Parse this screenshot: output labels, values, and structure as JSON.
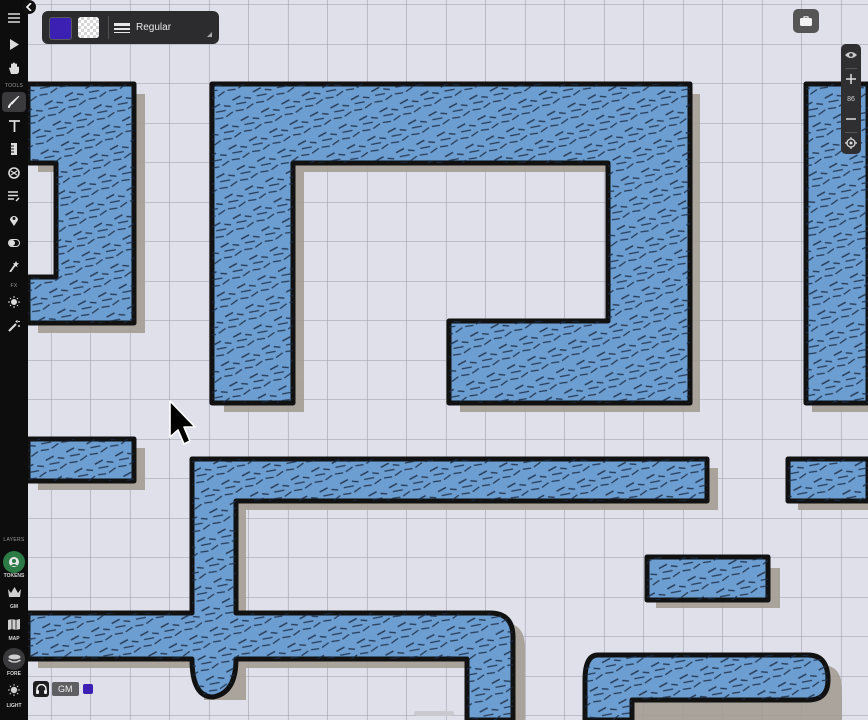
{
  "app": {
    "style_panel": {
      "fill_color": "#3c1fb3",
      "stroke_color": "transparent",
      "line_style_label": "Regular"
    },
    "toolbar": {
      "sections": {
        "tools": "TOOLS",
        "fx": "FX",
        "layers": "LAYERS"
      },
      "layers": [
        {
          "label": "TOKENS",
          "icon": "tokens-icon",
          "active": true
        },
        {
          "label": "GM",
          "icon": "crown-icon"
        },
        {
          "label": "MAP",
          "icon": "map-icon"
        },
        {
          "label": "FORE",
          "icon": "stack-icon"
        },
        {
          "label": "LIGHT",
          "icon": "light-icon"
        }
      ]
    },
    "zoom": {
      "level": "86"
    },
    "footer": {
      "user_label": "GM",
      "user_color": "#3c1fb3"
    }
  },
  "colors": {
    "grid_background": "#dfe0ea",
    "grid_line": "#9a9ba8",
    "water": "#6d9ed2",
    "outline": "#111111",
    "shadow": "#a49d93"
  }
}
